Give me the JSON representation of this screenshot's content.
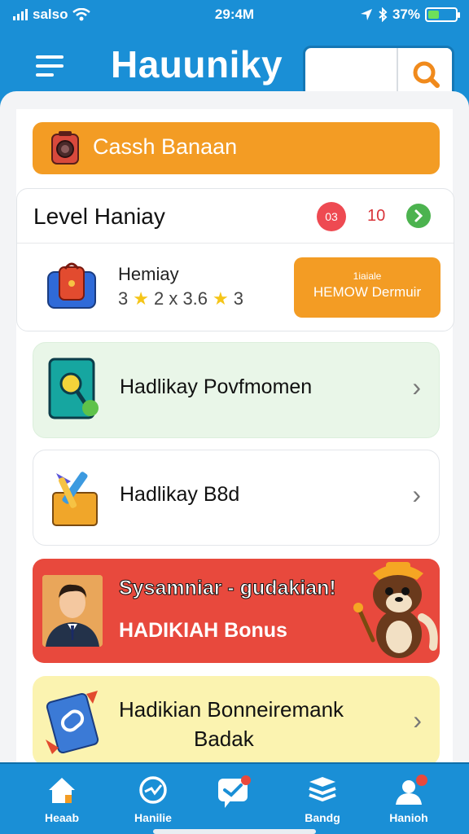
{
  "status_bar": {
    "carrier": "salso",
    "time": "29:4M",
    "battery_text": "37%",
    "battery_level": 0.37
  },
  "header": {
    "title": "Hauuniky",
    "search_placeholder": "",
    "menu_icon": "hamburger-menu-icon",
    "search_icon": "search-icon"
  },
  "cash_banner": {
    "label": "Cassh Banaan",
    "icon": "camera-icon"
  },
  "level": {
    "title": "Level Haniay",
    "badge": "03",
    "count": "10",
    "go_icon": "chevron-right-icon",
    "item_name": "Hemiay",
    "rating_text_1": "3",
    "rating_text_2": "2 x 3.6",
    "rating_text_3": "3",
    "bonus_small": "1iaiale",
    "bonus_big": "HEMOW Dermuir"
  },
  "items": [
    {
      "title": "Hadlikay Povfmomen",
      "icon": "search-book-icon"
    },
    {
      "title": "Hadlikay B8d",
      "icon": "toolbox-icon"
    }
  ],
  "promo": {
    "headline": "Sysamniar - gudakian!",
    "subline": "HADIKIAH Bonus",
    "avatar": "person-avatar",
    "mascot": "bear-mascot"
  },
  "bonus_card": {
    "title_line1": "Hadikian Bonneiremank",
    "title_line2": "Badak",
    "icon": "coupon-icon"
  },
  "nav": [
    {
      "label": "Heaab",
      "icon": "home-icon"
    },
    {
      "label": "Hanilie",
      "icon": "compass-icon"
    },
    {
      "label": "",
      "icon": "chat-icon"
    },
    {
      "label": "Bandg",
      "icon": "layers-icon"
    },
    {
      "label": "Hanioh",
      "icon": "profile-icon"
    }
  ],
  "colors": {
    "primary": "#1a8fd6",
    "orange": "#f39c24",
    "red": "#e8493d",
    "green": "#4cb34f"
  }
}
